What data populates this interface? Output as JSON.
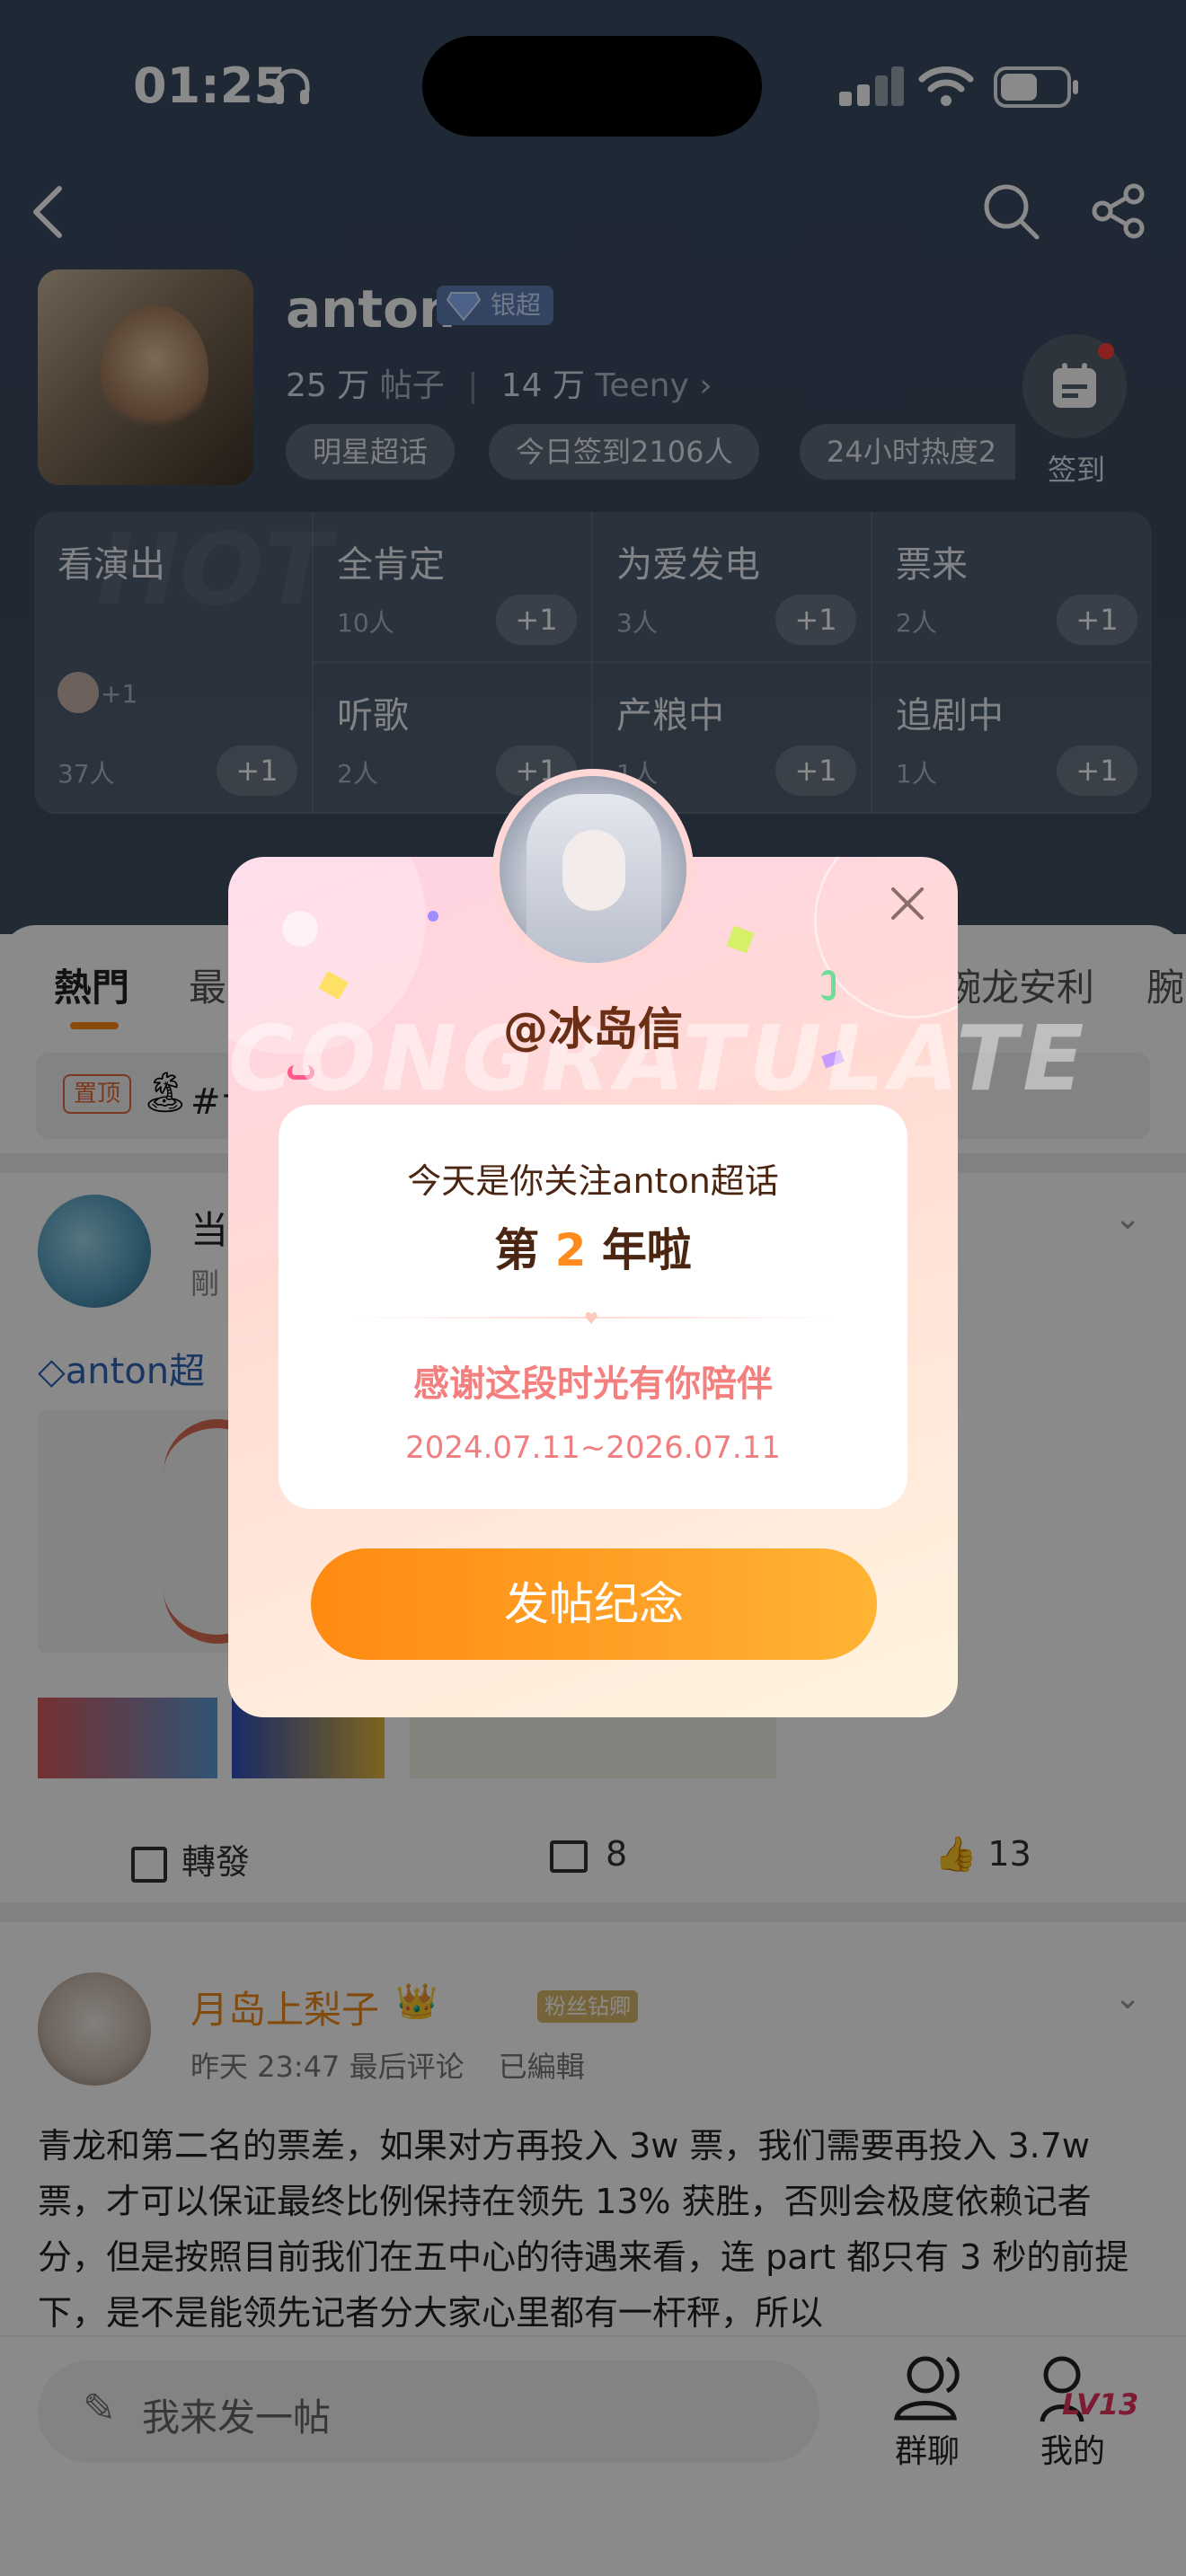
{
  "status_bar": {
    "time": "01:25"
  },
  "header": {
    "name": "anton",
    "badge": "银超",
    "stats_posts": "25 万",
    "stats_posts_label": "帖子",
    "stats_fans": "14 万",
    "stats_fans_label": "Teeny",
    "chips": [
      "明星超话",
      "今日签到2106人",
      "24小时热度2"
    ],
    "checkin_label": "签到",
    "grid_watermark": "HOT",
    "grid": [
      {
        "title": "看演出",
        "count": "37人",
        "plus": "+1",
        "avatar_count": "+1"
      },
      {
        "title": "全肯定",
        "count": "10人",
        "plus": "+1"
      },
      {
        "title": "为爱发电",
        "count": "3人",
        "plus": "+1"
      },
      {
        "title": "票来",
        "count": "2人",
        "plus": "+1"
      },
      {
        "title": "听歌",
        "count": "2人",
        "plus": "+1"
      },
      {
        "title": "产粮中",
        "count": "1人",
        "plus": "+1"
      },
      {
        "title": "追剧中",
        "count": "1人",
        "plus": "+1"
      }
    ]
  },
  "tabs": {
    "hot": "熱門",
    "latest": "最",
    "t3": "豌龙安利",
    "t4": "腕"
  },
  "pinned": {
    "tag": "置顶",
    "text": "#ナ"
  },
  "post1": {
    "name": "当",
    "time": "剛",
    "body": "anton超",
    "forward": "轉發",
    "comments": "8",
    "likes": "13"
  },
  "post2": {
    "name": "月岛上梨子",
    "tag": "粉丝钻卿",
    "meta": "昨天 23:47 最后评论",
    "edited": "已編輯",
    "body": "青龙和第二名的票差，如果对方再投入 3w 票，我们需要再投入 3.7w 票，才可以保证最终比例保持在领先 13% 获胜，否则会极度依赖记者分，但是按照目前我们在五中心的待遇来看，连 part 都只有 3 秒的前提下，是不是能领先记者分大家心里都有一杆秤，所以"
  },
  "bottom": {
    "compose_placeholder": "我来发一帖",
    "group_chat": "群聊",
    "mine": "我的",
    "level": "LV13"
  },
  "modal": {
    "username": "@冰岛信",
    "bg_word": "CONGRATULATE",
    "line1": "今天是你关注anton超话",
    "line2_pre": "第",
    "line2_num": "2",
    "line2_post": "年啦",
    "thanks": "感谢这段时光有你陪伴",
    "range": "2024.07.11~2026.07.11",
    "cta": "发帖纪念"
  },
  "colors": {
    "accent": "#ff8a12",
    "overlay": "#000000"
  }
}
